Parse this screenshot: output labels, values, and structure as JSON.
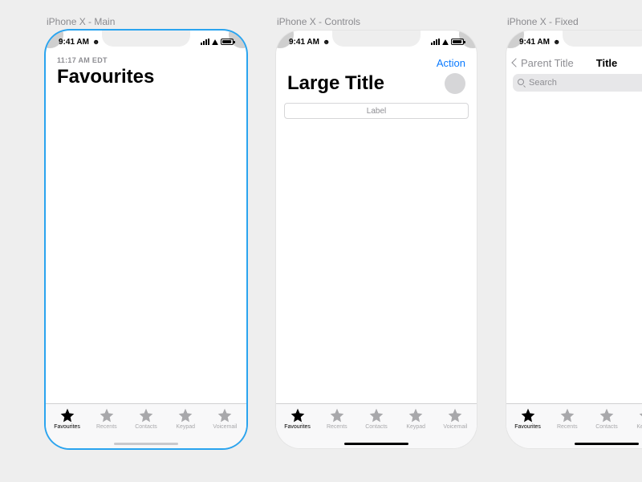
{
  "labels": {
    "frame1": "iPhone X - Main",
    "frame2": "iPhone X - Controls",
    "frame3": "iPhone X - Fixed"
  },
  "status": {
    "time": "9:41 AM"
  },
  "screen1": {
    "sub_time": "11:17 AM EDT",
    "title": "Favourites"
  },
  "screen2": {
    "action": "Action",
    "title": "Large Title",
    "segmented_label": "Label"
  },
  "screen3": {
    "back_label": "Parent Title",
    "title": "Title",
    "search_placeholder": "Search"
  },
  "tabs": [
    {
      "label": "Favourites",
      "active": true
    },
    {
      "label": "Recents",
      "active": false
    },
    {
      "label": "Contacts",
      "active": false
    },
    {
      "label": "Keypad",
      "active": false
    },
    {
      "label": "Voicemail",
      "active": false
    }
  ]
}
